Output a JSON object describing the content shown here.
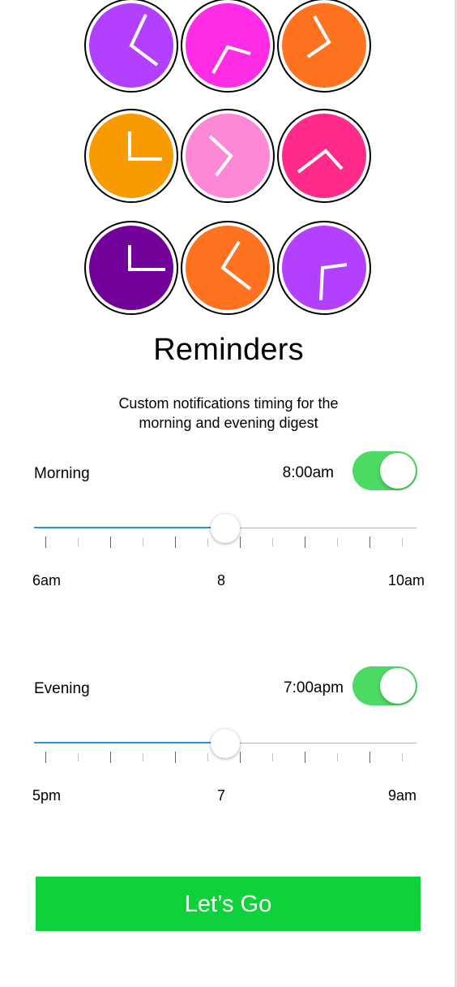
{
  "clocks": [
    {
      "color": "#b340ff",
      "icon": "clock-icon"
    },
    {
      "color": "#ff2ce6",
      "icon": "clock-icon"
    },
    {
      "color": "#ff7220",
      "icon": "clock-icon"
    },
    {
      "color": "#f89b00",
      "icon": "clock-icon"
    },
    {
      "color": "#ff88d6",
      "icon": "clock-icon"
    },
    {
      "color": "#ff2a8a",
      "icon": "clock-icon"
    },
    {
      "color": "#72009a",
      "icon": "clock-icon"
    },
    {
      "color": "#ff7220",
      "icon": "clock-icon"
    },
    {
      "color": "#b340ff",
      "icon": "clock-icon"
    }
  ],
  "title": "Reminders",
  "subtitle_line1": "Custom notifications timing for the",
  "subtitle_line2": "morning and evening digest",
  "morning": {
    "label": "Morning",
    "time": "8:00am",
    "enabled": true,
    "slider_value": 0.5,
    "scale_start": "6am",
    "scale_mid": "8",
    "scale_end": "10am"
  },
  "evening": {
    "label": "Evening",
    "time": "7:00apm",
    "enabled": true,
    "slider_value": 0.5,
    "scale_start": "5pm",
    "scale_mid": "7",
    "scale_end": "9am"
  },
  "button_label": "Let’s Go",
  "colors": {
    "toggle_on": "#4cd964",
    "slider_fill": "#2f8fe0",
    "button": "#0fd13b"
  }
}
